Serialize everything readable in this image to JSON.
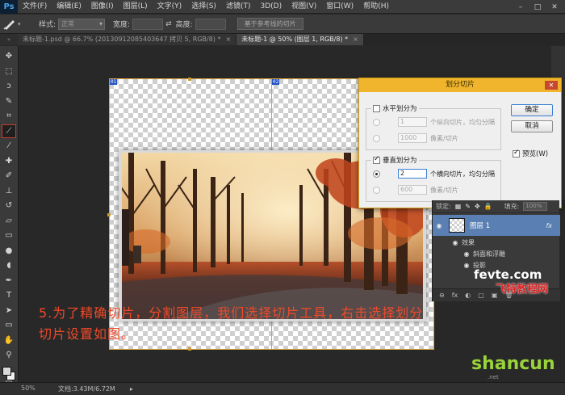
{
  "app": {
    "logo": "Ps",
    "menu": [
      "文件(F)",
      "编辑(E)",
      "图像(I)",
      "图层(L)",
      "文字(Y)",
      "选择(S)",
      "滤镜(T)",
      "3D(D)",
      "视图(V)",
      "窗口(W)",
      "帮助(H)"
    ],
    "window_buttons": [
      "–",
      "□",
      "✕"
    ]
  },
  "options_bar": {
    "tool_icon": "slice-tool-icon",
    "style_label": "样式:",
    "style_value": "正常",
    "width_label": "宽度:",
    "swap_glyph": "⇄",
    "height_label": "高度:",
    "guides_button": "基于参考线的切片"
  },
  "tabs": [
    {
      "label": "未标题-1.psd @ 66.7% (20130912085403647 拷贝 5, RGB/8) *",
      "active": false
    },
    {
      "label": "未标题-1 @ 50% (图层 1, RGB/8) *",
      "active": true
    }
  ],
  "tab_close": "×",
  "tools": [
    {
      "name": "move-tool-icon",
      "glyph": "✥"
    },
    {
      "name": "marquee-tool-icon",
      "glyph": "⬚"
    },
    {
      "name": "lasso-tool-icon",
      "glyph": "ↄ"
    },
    {
      "name": "quick-select-tool-icon",
      "glyph": "✎"
    },
    {
      "name": "crop-tool-icon",
      "glyph": "⌗"
    },
    {
      "name": "slice-tool-icon",
      "glyph": "⟋",
      "selected": true
    },
    {
      "name": "eyedropper-tool-icon",
      "glyph": "⁄"
    },
    {
      "name": "healing-brush-tool-icon",
      "glyph": "✚"
    },
    {
      "name": "brush-tool-icon",
      "glyph": "✐"
    },
    {
      "name": "stamp-tool-icon",
      "glyph": "⊥"
    },
    {
      "name": "history-brush-tool-icon",
      "glyph": "↺"
    },
    {
      "name": "eraser-tool-icon",
      "glyph": "▱"
    },
    {
      "name": "gradient-tool-icon",
      "glyph": "▭"
    },
    {
      "name": "blur-tool-icon",
      "glyph": "●"
    },
    {
      "name": "dodge-tool-icon",
      "glyph": "◖"
    },
    {
      "name": "pen-tool-icon",
      "glyph": "✒"
    },
    {
      "name": "type-tool-icon",
      "glyph": "T"
    },
    {
      "name": "path-select-tool-icon",
      "glyph": "➤"
    },
    {
      "name": "shape-tool-icon",
      "glyph": "▭"
    },
    {
      "name": "hand-tool-icon",
      "glyph": "✋"
    },
    {
      "name": "zoom-tool-icon",
      "glyph": "⚲"
    }
  ],
  "canvas": {
    "slice_tags": [
      "01",
      "02"
    ]
  },
  "dialog": {
    "title": "划分切片",
    "close_glyph": "✕",
    "horizontal": {
      "label": "水平划分为",
      "checked": false,
      "count_value": "1",
      "count_suffix": "个纵向切片，均匀分隔",
      "pixel_value": "1000",
      "pixel_suffix": "像素/切片"
    },
    "vertical": {
      "label": "垂直划分为",
      "checked": true,
      "count_value": "2",
      "count_suffix": "个横向切片，均匀分隔",
      "pixel_value": "600",
      "pixel_suffix": "像素/切片"
    },
    "ok_button": "确定",
    "cancel_button": "取消",
    "preview_label": "预览(W)",
    "preview_checked": true
  },
  "layers_panel": {
    "lock_label": "锁定:",
    "fill_label": "填充:",
    "fill_value": "100%",
    "layer_name": "图层 1",
    "fx_badge": "fx",
    "effects_label": "效果",
    "effect_items": [
      "斜面和浮雕",
      "投影"
    ],
    "bottom_icons": [
      "⊖",
      "fx",
      "◐",
      "▢",
      "▣",
      "🗑"
    ]
  },
  "annotation": {
    "line1": "5.为了精确切片，分割图层，我们选择切片工具，右击选择划分",
    "line2": "切片设置如图。"
  },
  "status": {
    "zoom": "50%",
    "doc_info": "文档:3.43M/6.72M",
    "arrow": "▸"
  },
  "watermarks": {
    "fevte": "fevte.com",
    "fevte_cn": "飞特教程网",
    "shancun": "shancun",
    "shancun_sub": ".net"
  },
  "colors": {
    "accent_dialog_title": "#f0b52c",
    "annotation_red": "#f04a2a",
    "slice_guide": "#d8a33a",
    "layer_selected": "#5a7fb3"
  }
}
